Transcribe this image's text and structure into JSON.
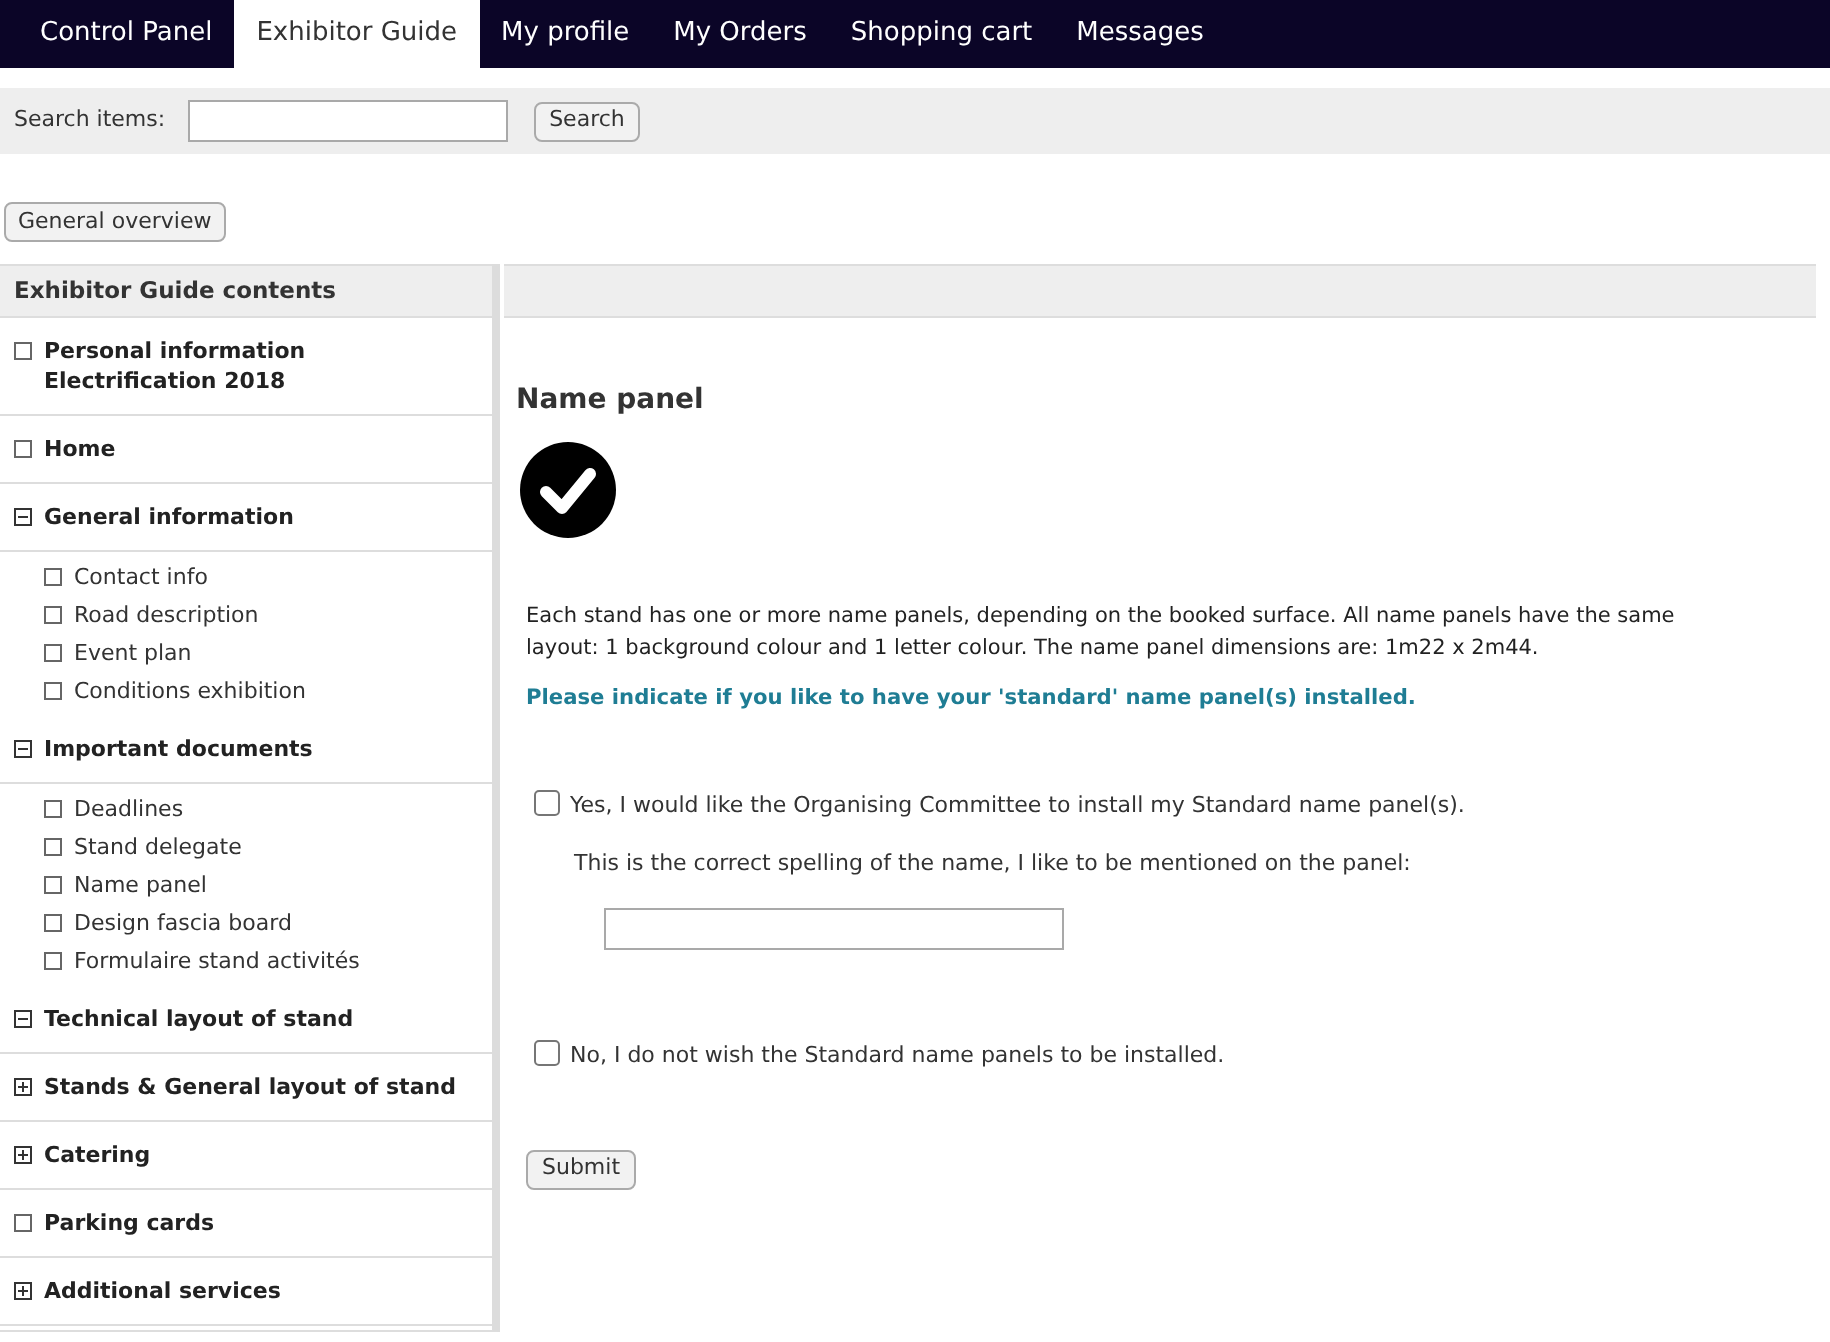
{
  "nav_tabs": [
    {
      "label": "Control Panel",
      "selected": false
    },
    {
      "label": "Exhibitor Guide",
      "selected": true
    },
    {
      "label": "My profile",
      "selected": false
    },
    {
      "label": "My Orders",
      "selected": false
    },
    {
      "label": "Shopping cart",
      "selected": false
    },
    {
      "label": "Messages",
      "selected": false
    }
  ],
  "search": {
    "label": "Search items:",
    "button": "Search"
  },
  "overview_button": "General overview",
  "sidebar": {
    "title": "Exhibitor Guide contents",
    "items": [
      {
        "label": "Personal information Electrification 2018",
        "kind": "page"
      },
      {
        "label": "Home",
        "kind": "page"
      },
      {
        "label": "General information",
        "kind": "folder",
        "expanded": true,
        "children": [
          {
            "label": "Contact info"
          },
          {
            "label": "Road description"
          },
          {
            "label": "Event plan"
          },
          {
            "label": "Conditions exhibition"
          }
        ]
      },
      {
        "label": "Important documents",
        "kind": "folder",
        "expanded": true,
        "children": [
          {
            "label": "Deadlines"
          },
          {
            "label": "Stand delegate"
          },
          {
            "label": "Name panel"
          },
          {
            "label": "Design fascia board"
          },
          {
            "label": "Formulaire stand activités"
          }
        ]
      },
      {
        "label": "Technical layout of stand",
        "kind": "folder",
        "expanded": true
      },
      {
        "label": "Stands & General layout of stand",
        "kind": "folder",
        "expanded": false
      },
      {
        "label": "Catering",
        "kind": "folder",
        "expanded": false
      },
      {
        "label": "Parking cards",
        "kind": "page"
      },
      {
        "label": "Additional services",
        "kind": "folder",
        "expanded": false
      }
    ]
  },
  "content": {
    "title": "Name panel",
    "description": "Each stand has one or more name panels, depending on the booked surface. All name panels have the same layout: 1 background colour and 1 letter colour. The name panel dimensions are: 1m22 x 2m44.",
    "prompt": "Please indicate if you like to have your 'standard' name panel(s) installed.",
    "options": [
      {
        "label": "Yes, I would like the Organising Committee to install my Standard name panel(s).",
        "checked": false,
        "field_label": "This is the correct spelling of the name, I like to be mentioned on the panel:"
      },
      {
        "label": "No, I do not wish the Standard name panels to be installed.",
        "checked": false
      }
    ],
    "submit": "Submit"
  }
}
